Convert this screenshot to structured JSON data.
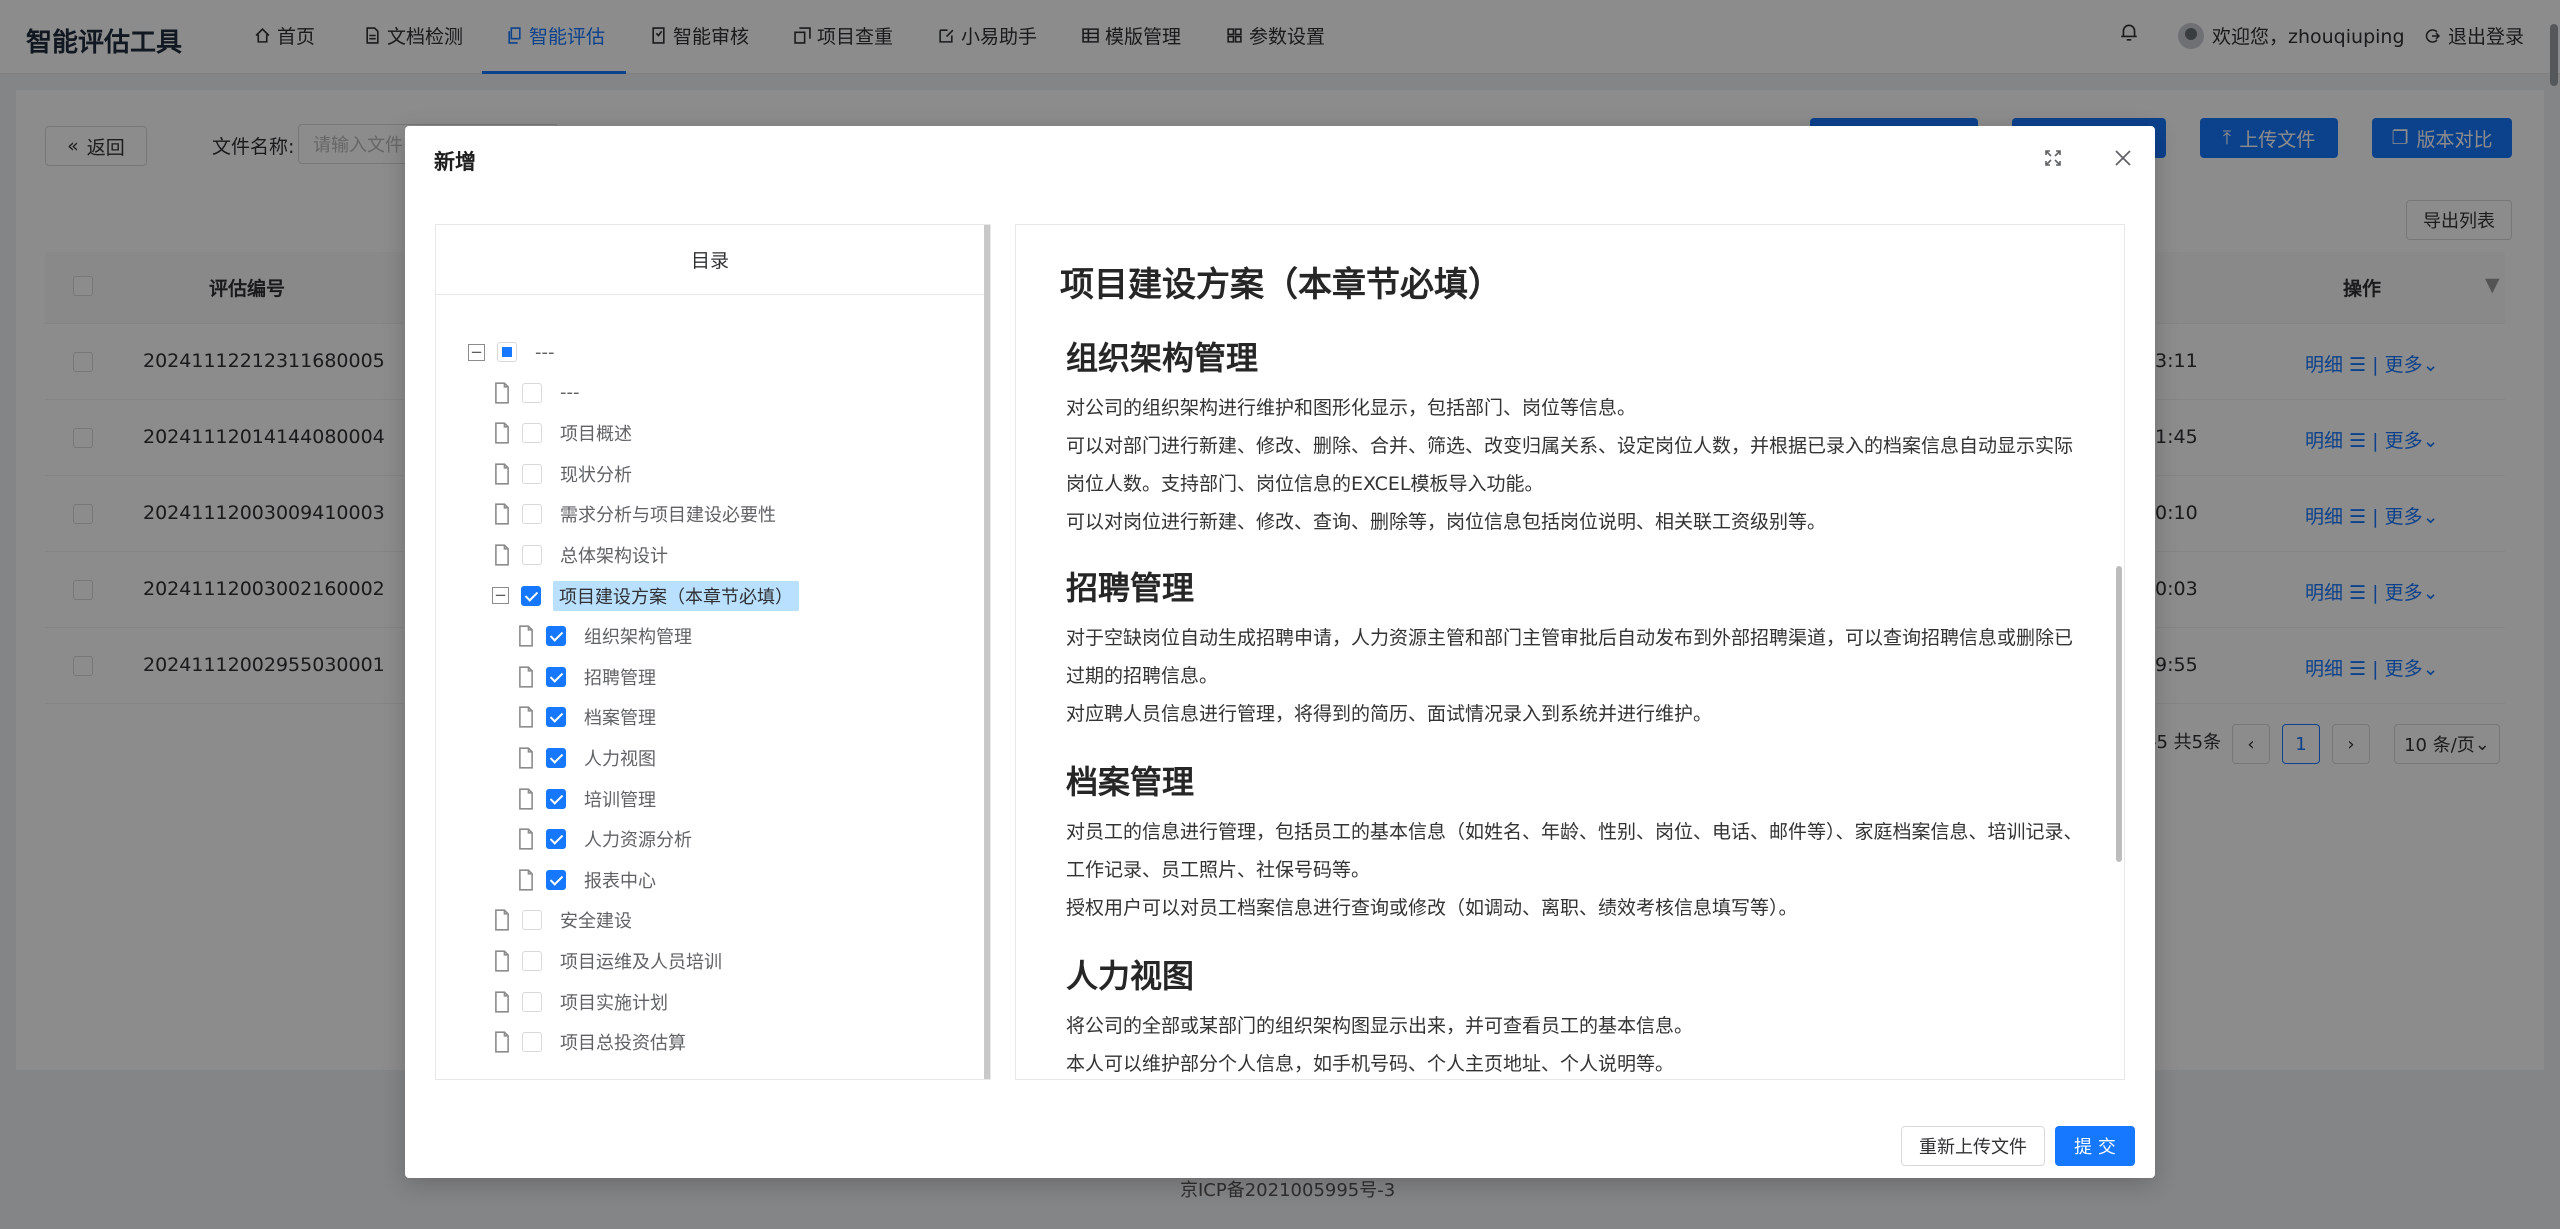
{
  "app": {
    "title": "智能评估工具"
  },
  "nav": {
    "items": [
      {
        "label": "首页",
        "icon": "home-icon"
      },
      {
        "label": "文档检测",
        "icon": "document-icon"
      },
      {
        "label": "智能评估",
        "icon": "copy-icon",
        "active": true
      },
      {
        "label": "智能审核",
        "icon": "audit-icon"
      },
      {
        "label": "项目查重",
        "icon": "duplicate-icon"
      },
      {
        "label": "小易助手",
        "icon": "edit-icon"
      },
      {
        "label": "模版管理",
        "icon": "table-icon"
      },
      {
        "label": "参数设置",
        "icon": "grid-icon"
      }
    ]
  },
  "header": {
    "welcome": "欢迎您，zhouqiuping",
    "logout": "退出登录"
  },
  "toolbar": {
    "back": "返回",
    "file_name_label": "文件名称:",
    "file_name_placeholder": "请输入文件",
    "upload": "上传文件",
    "compare": "版本对比",
    "export": "导出列表"
  },
  "table": {
    "headers": {
      "id": "评估编号",
      "ops": "操作"
    },
    "rows": [
      {
        "id": "2024111221231168000​5",
        "time": "3:11"
      },
      {
        "id": "2024111201414408000​4",
        "time": "1:45"
      },
      {
        "id": "2024111200300941000​3",
        "time": "0:10"
      },
      {
        "id": "2024111200300216000​2",
        "time": "0:03"
      },
      {
        "id": "2024111200295503000​1",
        "time": "9:55"
      }
    ],
    "op_detail": "明细",
    "op_more": "更多",
    "pager_total": "-5 共5条",
    "pager_page": "1",
    "pager_size": "10 条/页"
  },
  "footer": {
    "icp": "京ICP备2021005995号-3"
  },
  "modal": {
    "title": "新增",
    "toc_title": "目录",
    "tree": [
      {
        "label": "---",
        "level": 0,
        "expander": "−",
        "state": "partial"
      },
      {
        "label": "---",
        "level": 1,
        "state": "none"
      },
      {
        "label": "项目概述",
        "level": 1,
        "state": "none"
      },
      {
        "label": "现状分析",
        "level": 1,
        "state": "none"
      },
      {
        "label": "需求分析与项目建设必要性",
        "level": 1,
        "state": "none"
      },
      {
        "label": "总体架构设计",
        "level": 1,
        "state": "none"
      },
      {
        "label": "项目建设方案（本章节必填）",
        "level": 1,
        "expander": "−",
        "state": "checked",
        "selected": true
      },
      {
        "label": "组织架构管理",
        "level": 2,
        "state": "checked"
      },
      {
        "label": "招聘管理",
        "level": 2,
        "state": "checked"
      },
      {
        "label": "档案管理",
        "level": 2,
        "state": "checked"
      },
      {
        "label": "人力视图",
        "level": 2,
        "state": "checked"
      },
      {
        "label": "培训管理",
        "level": 2,
        "state": "checked"
      },
      {
        "label": "人力资源分析",
        "level": 2,
        "state": "checked"
      },
      {
        "label": "报表中心",
        "level": 2,
        "state": "checked"
      },
      {
        "label": "安全建设",
        "level": 1,
        "state": "none"
      },
      {
        "label": "项目运维及人员培训",
        "level": 1,
        "state": "none"
      },
      {
        "label": "项目实施计划",
        "level": 1,
        "state": "none"
      },
      {
        "label": "项目总投资估算",
        "level": 1,
        "state": "none"
      }
    ],
    "doc": {
      "title": "项目建设方案（本章节必填）",
      "sections": [
        {
          "heading": "组织架构管理",
          "paragraphs": [
            "对公司的组织架构进行维护和图形化显示，包括部门、岗位等信息。",
            "可以对部门进行新建、修改、删除、合并、筛选、改变归属关系、设定岗位人数，并根据已录入的档案信息自动显示实际岗位人数。支持部门、岗位信息的EXCEL模板导入功能。",
            "可以对岗位进行新建、修改、查询、删除等，岗位信息包括岗位说明、相关联工资级别等。"
          ]
        },
        {
          "heading": "招聘管理",
          "paragraphs": [
            "对于空缺岗位自动生成招聘申请，人力资源主管和部门主管审批后自动发布到外部招聘渠道，可以查询招聘信息或删除已过期的招聘信息。",
            "对应聘人员信息进行管理，将得到的简历、面试情况录入到系统并进行维护。"
          ]
        },
        {
          "heading": "档案管理",
          "paragraphs": [
            "对员工的信息进行管理，包括员工的基本信息（如姓名、年龄、性别、岗位、电话、邮件等）、家庭档案信息、培训记录、工作记录、员工照片、社保号码等。",
            "授权用户可以对员工档案信息进行查询或修改（如调动、离职、绩效考核信息填写等）。"
          ]
        },
        {
          "heading": "人力视图",
          "paragraphs": [
            "将公司的全部或某部门的组织架构图显示出来，并可查看员工的基本信息。",
            "本人可以维护部分个人信息，如手机号码、个人主页地址、个人说明等。"
          ]
        }
      ]
    },
    "reupload": "重新上传文件",
    "submit": "提 交"
  },
  "colors": {
    "accent": "#1677ff"
  }
}
